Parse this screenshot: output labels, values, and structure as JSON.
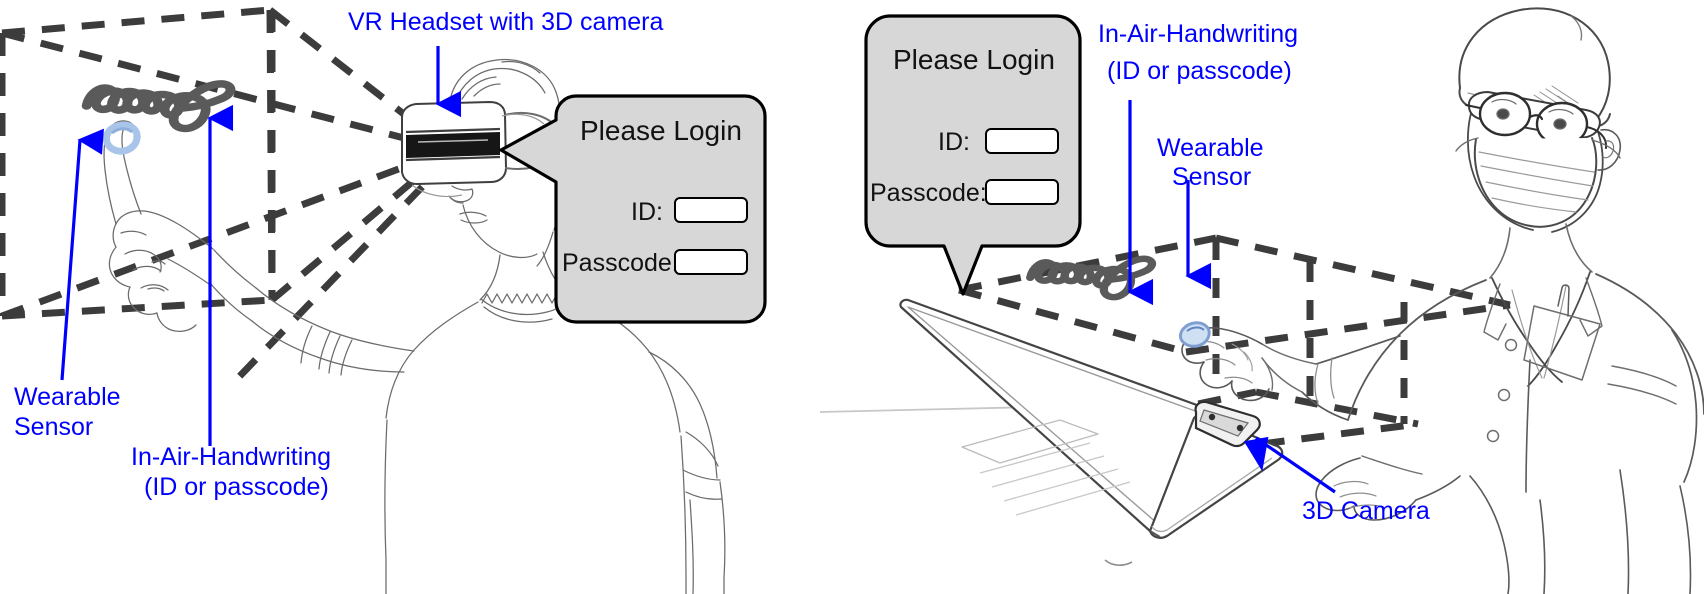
{
  "figure": {
    "domain": "diagram",
    "description": "Two-panel line-art illustration of in-air handwriting authentication",
    "accent_blue": "#0000FF",
    "bubble_fill": "#D7D7D7",
    "bubble_stroke": "#000000",
    "dash_stroke": "#3C3C3C",
    "sketch_stroke": "#5A5A5A",
    "sensor_ring_color": "#A8C4E8"
  },
  "left_panel": {
    "name": "vr-headset-scenario",
    "annotations": [
      {
        "id": "vr-headset",
        "text": "VR Headset with 3D camera",
        "color": "#0000FF"
      },
      {
        "id": "wearable-sensor",
        "line1": "Wearable",
        "line2": "Sensor",
        "color": "#0000FF"
      },
      {
        "id": "in-air-handwriting",
        "line1": "In-Air-Handwriting",
        "line2": "(ID or passcode)",
        "color": "#0000FF"
      }
    ],
    "login_panel": {
      "title": "Please Login",
      "fields": [
        {
          "label": "ID:",
          "value": "",
          "placeholder": ""
        },
        {
          "label": "Passcode:",
          "value": "",
          "placeholder": ""
        }
      ]
    },
    "handwriting_glyph": "cursive-signature"
  },
  "right_panel": {
    "name": "laptop-3d-camera-scenario",
    "annotations": [
      {
        "id": "in-air-handwriting",
        "line1": "In-Air-Handwriting",
        "line2": "(ID or passcode)",
        "color": "#0000FF"
      },
      {
        "id": "wearable-sensor",
        "line1": "Wearable",
        "line2": "Sensor",
        "color": "#0000FF"
      },
      {
        "id": "3d-camera",
        "text": "3D Camera",
        "color": "#0000FF"
      }
    ],
    "login_panel": {
      "title": "Please Login",
      "fields": [
        {
          "label": "ID:",
          "value": "",
          "placeholder": ""
        },
        {
          "label": "Passcode:",
          "value": "",
          "placeholder": ""
        }
      ]
    },
    "handwriting_glyph": "cursive-signature"
  }
}
